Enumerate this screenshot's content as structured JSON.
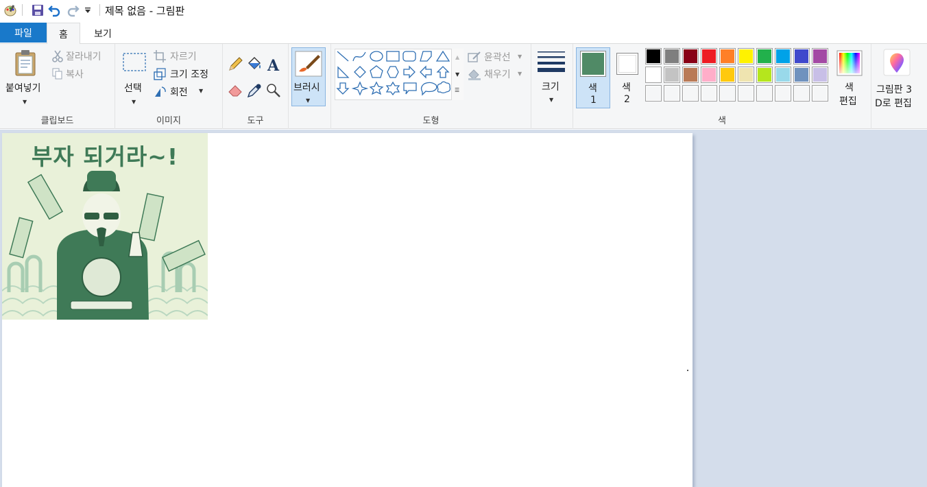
{
  "window": {
    "title": "제목 없음 - 그림판"
  },
  "quick_access": [
    {
      "name": "app-icon"
    },
    {
      "name": "save-icon"
    },
    {
      "name": "undo-icon"
    },
    {
      "name": "redo-icon"
    },
    {
      "name": "customize-dropdown-icon"
    }
  ],
  "tabs": {
    "file": "파일",
    "home": "홈",
    "view": "보기",
    "active": "홈"
  },
  "clipboard": {
    "paste": "붙여넣기",
    "cut": "잘라내기",
    "copy": "복사",
    "label": "클립보드"
  },
  "image": {
    "select": "선택",
    "crop": "자르기",
    "resize": "크기 조정",
    "rotate": "회전",
    "label": "이미지"
  },
  "tools": {
    "label": "도구"
  },
  "brush": {
    "label": "브러시"
  },
  "shapes": {
    "outline": "윤곽선",
    "fill": "채우기",
    "label": "도형"
  },
  "size": {
    "label": "크기"
  },
  "colors": {
    "color1_line1": "색",
    "color1_line2": "1",
    "color1_value": "#508a66",
    "color2_line1": "색",
    "color2_line2": "2",
    "color2_value": "#ffffff",
    "edit_line1": "색",
    "edit_line2": "편집",
    "label": "색",
    "palette_row1": [
      "#000000",
      "#7f7f7f",
      "#880015",
      "#ed1c24",
      "#ff7f27",
      "#fff200",
      "#22b14c",
      "#00a2e8",
      "#3f48cc",
      "#a349a4"
    ],
    "palette_row2": [
      "#ffffff",
      "#c3c3c3",
      "#b97a57",
      "#ffaec9",
      "#ffc90e",
      "#efe4b0",
      "#b5e61d",
      "#99d9ea",
      "#7092be",
      "#c8bfe7"
    ],
    "palette_row3": [
      "#f5f6f7",
      "#f5f6f7",
      "#f5f6f7",
      "#f5f6f7",
      "#f5f6f7",
      "#f5f6f7",
      "#f5f6f7",
      "#f5f6f7",
      "#f5f6f7",
      "#f5f6f7"
    ]
  },
  "paint3d": {
    "line1": "그림판 3",
    "line2": "D로 편집"
  },
  "canvas": {
    "picture_caption": "부자 되거라~!"
  }
}
